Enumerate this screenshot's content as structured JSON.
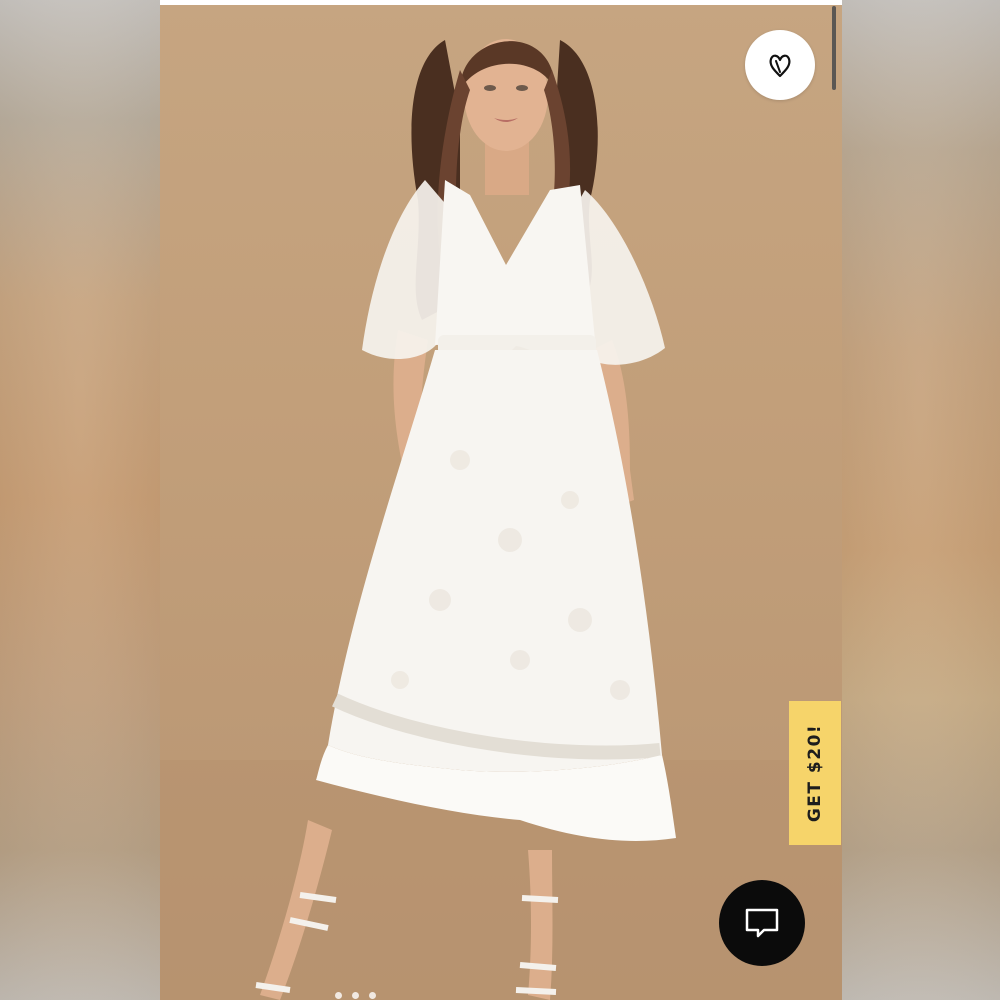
{
  "promo": {
    "label": "GET $20!"
  },
  "icons": {
    "like": "heart-icon",
    "chat": "chat-bubble-icon"
  },
  "colors": {
    "promo_background": "#f6d46a",
    "chat_background": "#0b0b0b",
    "photo_background": "#c29f7a"
  }
}
